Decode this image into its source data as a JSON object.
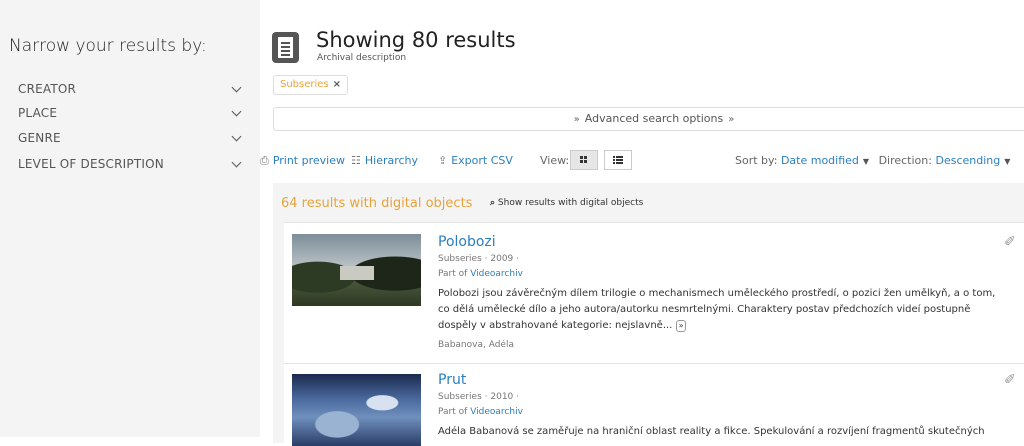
{
  "sidebar": {
    "title": "Narrow your results by:",
    "facets": [
      {
        "label": "CREATOR"
      },
      {
        "label": "PLACE"
      },
      {
        "label": "GENRE"
      },
      {
        "label": "LEVEL OF DESCRIPTION"
      }
    ]
  },
  "header": {
    "title": "Showing 80 results",
    "subtitle": "Archival description"
  },
  "filters": [
    {
      "label": "Subseries",
      "remove": "×"
    }
  ],
  "advanced_search": {
    "label": "Advanced search options"
  },
  "toolbar": {
    "print_preview": "Print preview",
    "hierarchy": "Hierarchy",
    "export_csv": "Export CSV",
    "view_label": "View:",
    "sort_label": "Sort by:",
    "sort_value": "Date modified",
    "direction_label": "Direction:",
    "direction_value": "Descending"
  },
  "digital": {
    "heading": "64 results with digital objects",
    "link": "Show results with digital objects"
  },
  "results": [
    {
      "title": "Polobozi",
      "meta": "Subseries · 2009 ·",
      "part_of_label": "Part of",
      "part_of": "Videoarchiv",
      "desc": "Polobozi jsou závěrečným dílem trilogie o mechanismech uměleckého prostředí, o pozici žen umělkyň, a o tom, co dělá umělecké dílo a jeho autora/autorku nesmrtelnými. Charaktery postav předchozích videí postupně dospěly v abstrahované kategorie: nejslavně...",
      "more": "»",
      "author": "Babanova, Adéla"
    },
    {
      "title": "Prut",
      "meta": "Subseries · 2010 ·",
      "part_of_label": "Part of",
      "part_of": "Videoarchiv",
      "desc": "Adéla Babanová se zaměřuje na hraniční oblast reality a fikce. Spekulování a rozvíjení fragmentů skutečných"
    }
  ],
  "colors": {
    "link": "#2a7fc1",
    "accent": "#e8a33a",
    "sidebar_bg": "#f4f4f4"
  }
}
